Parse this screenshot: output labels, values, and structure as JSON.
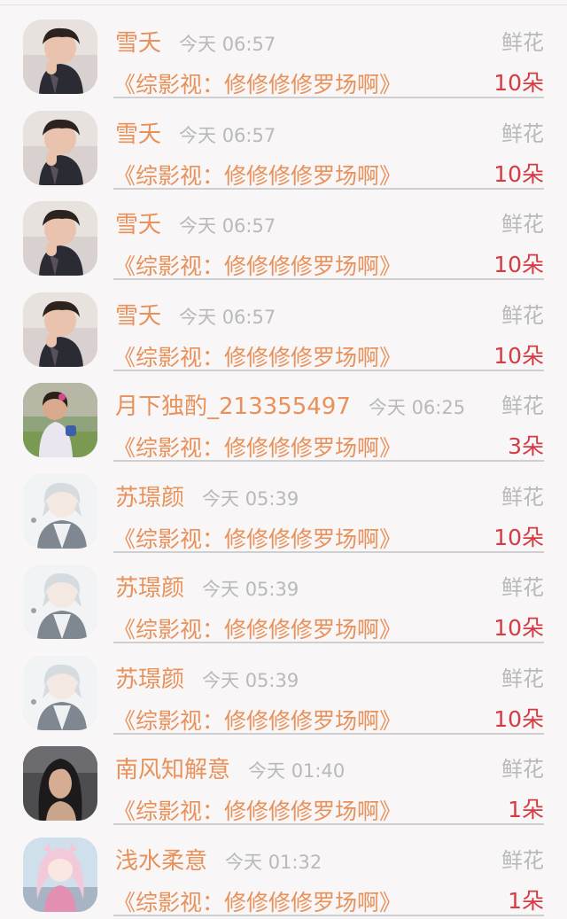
{
  "colors": {
    "name": "#e8915a",
    "book": "#e8915a",
    "time": "#b9b9b9",
    "gift_label": "#b9b9b9",
    "count": "#d63a43",
    "background": "#f8f6f6"
  },
  "items": [
    {
      "name": "雪夭",
      "time": "今天 06:57",
      "book": "《综影视：修修修修罗场啊》",
      "gift": "鲜花",
      "count": "10朵",
      "avatar": "avatar-man-icon"
    },
    {
      "name": "雪夭",
      "time": "今天 06:57",
      "book": "《综影视：修修修修罗场啊》",
      "gift": "鲜花",
      "count": "10朵",
      "avatar": "avatar-man-icon"
    },
    {
      "name": "雪夭",
      "time": "今天 06:57",
      "book": "《综影视：修修修修罗场啊》",
      "gift": "鲜花",
      "count": "10朵",
      "avatar": "avatar-man-icon"
    },
    {
      "name": "雪夭",
      "time": "今天 06:57",
      "book": "《综影视：修修修修罗场啊》",
      "gift": "鲜花",
      "count": "10朵",
      "avatar": "avatar-man-icon"
    },
    {
      "name": "月下独酌_213355497",
      "time": "今天 06:25",
      "book": "《综影视：修修修修罗场啊》",
      "gift": "鲜花",
      "count": "3朵",
      "avatar": "avatar-child-icon"
    },
    {
      "name": "苏璟颜",
      "time": "今天 05:39",
      "book": "《综影视：修修修修罗场啊》",
      "gift": "鲜花",
      "count": "10朵",
      "avatar": "avatar-anime-boy-icon"
    },
    {
      "name": "苏璟颜",
      "time": "今天 05:39",
      "book": "《综影视：修修修修罗场啊》",
      "gift": "鲜花",
      "count": "10朵",
      "avatar": "avatar-anime-boy-icon"
    },
    {
      "name": "苏璟颜",
      "time": "今天 05:39",
      "book": "《综影视：修修修修罗场啊》",
      "gift": "鲜花",
      "count": "10朵",
      "avatar": "avatar-anime-boy-icon"
    },
    {
      "name": "南风知解意",
      "time": "今天 01:40",
      "book": "《综影视：修修修修罗场啊》",
      "gift": "鲜花",
      "count": "1朵",
      "avatar": "avatar-woman-icon"
    },
    {
      "name": "浅水柔意",
      "time": "今天 01:32",
      "book": "《综影视：修修修修罗场啊》",
      "gift": "鲜花",
      "count": "1朵",
      "avatar": "avatar-anime-girl-icon"
    }
  ]
}
